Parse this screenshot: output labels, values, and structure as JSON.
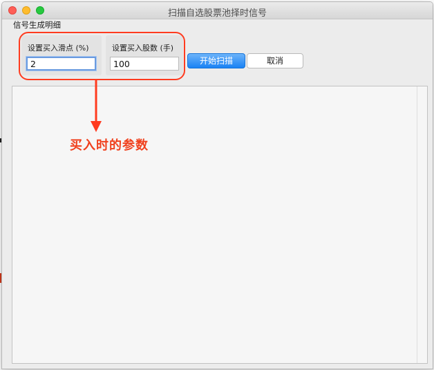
{
  "window": {
    "title": "扫描自选股票池择时信号"
  },
  "menu": {
    "items": [
      "信号生成明细"
    ]
  },
  "params": {
    "slippage": {
      "label": "设置买入滑点 (%)",
      "value": "2"
    },
    "shares": {
      "label": "设置买入股数 (手)",
      "value": "100"
    }
  },
  "buttons": {
    "start": "开始扫描",
    "cancel": "取消"
  },
  "annotation": {
    "text": "买入时的参数",
    "color": "#f0401d"
  },
  "colors": {
    "accent": "#1a82f4",
    "highlight": "#ff3b1f"
  }
}
